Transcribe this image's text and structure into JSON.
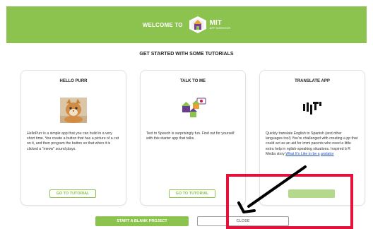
{
  "header": {
    "welcome": "WELCOME TO",
    "logo_title": "MIT",
    "logo_subtitle": "APP INVENTOR",
    "background_color": "#8cc34f"
  },
  "subtitle": "GET STARTED WITH SOME TUTORIALS",
  "tutorials": [
    {
      "title": "HELLO PURR",
      "icon": "cat-icon",
      "description": "HelloPurr is a simple app that you can build in a very short time. You create a button that has a picture of a cat on it, and then program the button so that when it is clicked a \"meow\" sound plays.",
      "button": "GO TO TUTORIAL"
    },
    {
      "title": "TALK TO ME",
      "icon": "talking-robots-icon",
      "description": "Text to Speech is surprisingly fun. Find out for yourself with this starter app that talks.",
      "button": "GO TO TUTORIAL"
    },
    {
      "title": "TRANSLATE APP",
      "icon": "yandex-translate-icon",
      "description_part1": "Quickly translate English to Spanish (and other languages too!) You're challenged with creating a",
      "description_part2": "pp that could act as an aid for immi",
      "description_part3": "parents who need a little extra help in",
      "description_part4": "nglish-speaking situations. Inspired b",
      "description_part5": "R Media story",
      "link_text": "What It's Like to be a",
      "link_tail": "anslator"
    }
  ],
  "footer": {
    "start_blank": "START A BLANK PROJECT",
    "close": "CLOSE"
  },
  "colors": {
    "accent": "#8cc34f",
    "highlight": "#e5113d",
    "link": "#1e4ec4"
  }
}
